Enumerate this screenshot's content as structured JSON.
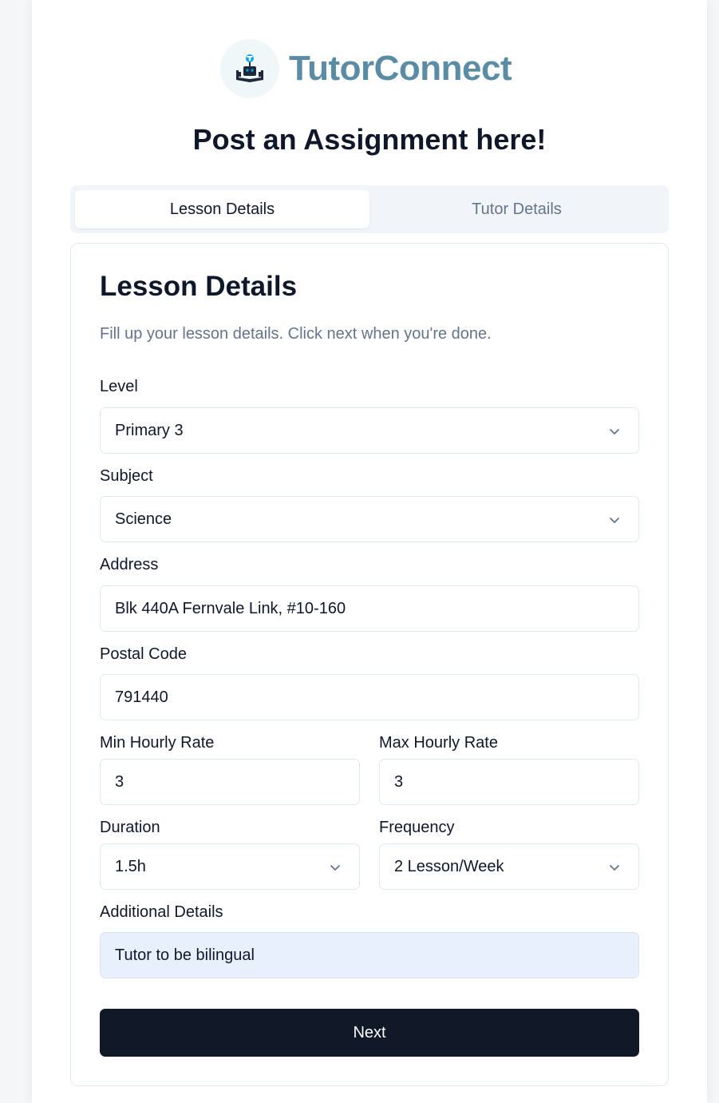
{
  "brand": {
    "name": "TutorConnect",
    "logo_icon": "book-tutor-icon",
    "color": "#5a8ca5"
  },
  "page": {
    "title": "Post an Assignment here!"
  },
  "tabs": [
    {
      "label": "Lesson Details",
      "active": true
    },
    {
      "label": "Tutor Details",
      "active": false
    }
  ],
  "card": {
    "title": "Lesson Details",
    "description": "Fill up your lesson details. Click next when you're done."
  },
  "form": {
    "level": {
      "label": "Level",
      "value": "Primary 3"
    },
    "subject": {
      "label": "Subject",
      "value": "Science"
    },
    "address": {
      "label": "Address",
      "value": "Blk 440A Fernvale Link, #10-160"
    },
    "postal_code": {
      "label": "Postal Code",
      "value": "791440"
    },
    "min_rate": {
      "label": "Min Hourly Rate",
      "value": "3"
    },
    "max_rate": {
      "label": "Max Hourly Rate",
      "value": "3"
    },
    "duration": {
      "label": "Duration",
      "value": "1.5h"
    },
    "frequency": {
      "label": "Frequency",
      "value": "2 Lesson/Week"
    },
    "additional": {
      "label": "Additional Details",
      "value": "Tutor to be bilingual"
    }
  },
  "actions": {
    "next_label": "Next"
  },
  "colors": {
    "primary_button": "#111827",
    "muted_text": "#64748b",
    "autofill_bg": "#e8f0fe"
  }
}
